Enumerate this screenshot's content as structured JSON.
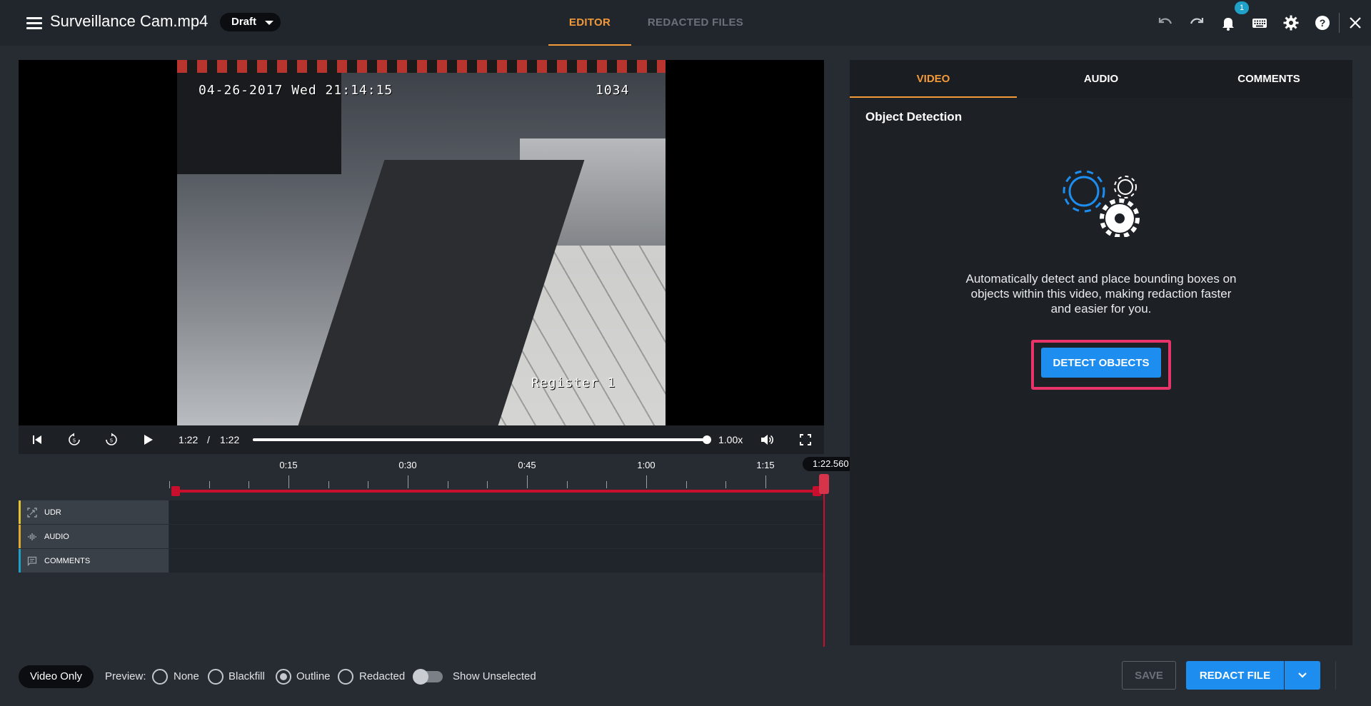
{
  "header": {
    "file_title": "Surveillance Cam.mp4",
    "status": "Draft",
    "tabs": [
      {
        "label": "EDITOR",
        "active": true
      },
      {
        "label": "REDACTED FILES",
        "active": false
      }
    ],
    "notification_count": "1",
    "icons": [
      "menu-icon",
      "undo-icon",
      "redo-icon",
      "bell-icon",
      "keyboard-icon",
      "gear-icon",
      "help-icon",
      "close-icon"
    ]
  },
  "video": {
    "overlay_timestamp": "04-26-2017 Wed 21:14:15",
    "overlay_camera": "1034",
    "overlay_register": "Register 1"
  },
  "player": {
    "current_time": "1:22",
    "separator": "/",
    "duration": "1:22",
    "progress_fraction": 1.0,
    "speed": "1.00x"
  },
  "timeline": {
    "ticks": [
      "0:15",
      "0:30",
      "0:45",
      "1:00",
      "1:15"
    ],
    "playhead_time": "1:22.560",
    "tracks": [
      {
        "label": "UDR",
        "accent": "#e2c230",
        "icon": "udr-icon"
      },
      {
        "label": "AUDIO",
        "accent": "#e2a930",
        "icon": "audio-wave-icon"
      },
      {
        "label": "COMMENTS",
        "accent": "#1ea0c9",
        "icon": "comment-icon"
      }
    ]
  },
  "panel": {
    "tabs": [
      {
        "label": "VIDEO",
        "active": true
      },
      {
        "label": "AUDIO",
        "active": false
      },
      {
        "label": "COMMENTS",
        "active": false
      }
    ],
    "section_title": "Object Detection",
    "description": "Automatically detect and place bounding boxes on objects within this video, making redaction faster and easier for you.",
    "detect_button": "DETECT OBJECTS"
  },
  "footer": {
    "video_only": "Video Only",
    "preview_label": "Preview:",
    "preview_options": [
      {
        "label": "None",
        "checked": false
      },
      {
        "label": "Blackfill",
        "checked": false
      },
      {
        "label": "Outline",
        "checked": true
      },
      {
        "label": "Redacted",
        "checked": false
      }
    ],
    "show_unselected": "Show Unselected",
    "show_unselected_on": false,
    "save": "SAVE",
    "redact": "REDACT FILE"
  },
  "colors": {
    "accent": "#f29a3a",
    "primary": "#1d8ef0",
    "timeline_red": "#c8102e",
    "highlight": "#e8336b"
  }
}
